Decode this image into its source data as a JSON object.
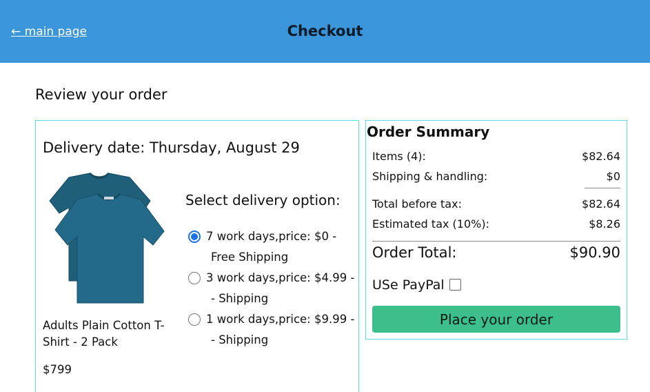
{
  "header": {
    "back_link": "← main page",
    "title": "Checkout"
  },
  "review_heading": "Review your order",
  "order": {
    "delivery_date": "Delivery date: Thursday, August 29",
    "product": {
      "name": "Adults Plain Cotton T-Shirt - 2 Pack",
      "price": "$799",
      "image_icon": "tshirt-pack-image"
    },
    "delivery_heading": "Select delivery option:",
    "options": [
      {
        "line1": "7 work days,price: $0 -",
        "line2": "Free Shipping",
        "selected": true
      },
      {
        "line1": "3 work days,price: $4.99 -",
        "line2": "- Shipping",
        "selected": false
      },
      {
        "line1": "1 work days,price: $9.99 -",
        "line2": "- Shipping",
        "selected": false
      }
    ]
  },
  "summary": {
    "title": "Order Summary",
    "rows": [
      {
        "label": "Items (4):",
        "value": "$82.64"
      },
      {
        "label": "Shipping & handling:",
        "value": "$0"
      },
      {
        "label": "Total before tax:",
        "value": "$82.64"
      },
      {
        "label": "Estimated tax (10%):",
        "value": "$8.26"
      }
    ],
    "total_label": "Order Total:",
    "total_value": "$90.90",
    "paypal_label": "USe PayPal",
    "paypal_checked": false,
    "place_order_label": "Place your order"
  },
  "colors": {
    "header_bg": "#3a95d9",
    "card_border": "#58dfe3",
    "button_bg": "#3cbf8a",
    "shirt": "#1f5f7a"
  }
}
